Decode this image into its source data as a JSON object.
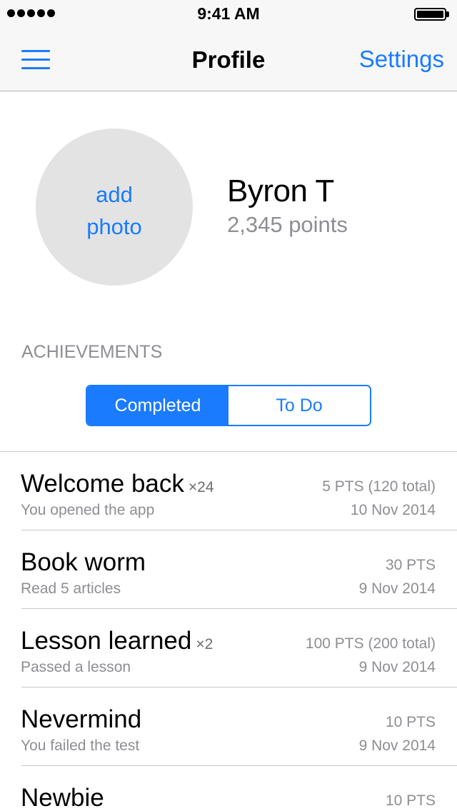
{
  "status_bar": {
    "time": "9:41 AM"
  },
  "nav": {
    "title": "Profile",
    "settings_label": "Settings"
  },
  "profile": {
    "avatar_label_line1": "add",
    "avatar_label_line2": "photo",
    "name": "Byron T",
    "points": "2,345 points"
  },
  "achievements": {
    "section_title": "ACHIEVEMENTS",
    "segments": [
      {
        "label": "Completed",
        "selected": true
      },
      {
        "label": "To Do",
        "selected": false
      }
    ],
    "items": [
      {
        "title": "Welcome back",
        "multiplier": "×24",
        "subtitle": "You opened the app",
        "points": "5 PTS (120 total)",
        "date": "10 Nov 2014"
      },
      {
        "title": "Book worm",
        "multiplier": "",
        "subtitle": "Read 5 articles",
        "points": "30 PTS",
        "date": "9 Nov 2014"
      },
      {
        "title": "Lesson learned",
        "multiplier": "×2",
        "subtitle": "Passed a lesson",
        "points": "100 PTS (200 total)",
        "date": "9 Nov 2014"
      },
      {
        "title": "Nevermind",
        "multiplier": "",
        "subtitle": "You failed the test",
        "points": "10 PTS",
        "date": "9 Nov 2014"
      },
      {
        "title": "Newbie",
        "multiplier": "",
        "subtitle": "",
        "points": "10 PTS",
        "date": ""
      }
    ]
  },
  "colors": {
    "accent": "#1a7bff",
    "secondary_text": "#8e8e93",
    "avatar_bg": "#e3e3e3",
    "bar_bg": "#f7f7f7"
  },
  "icons": {
    "menu": "hamburger-menu-icon",
    "signal": "signal-strength-icon",
    "battery": "battery-icon"
  }
}
